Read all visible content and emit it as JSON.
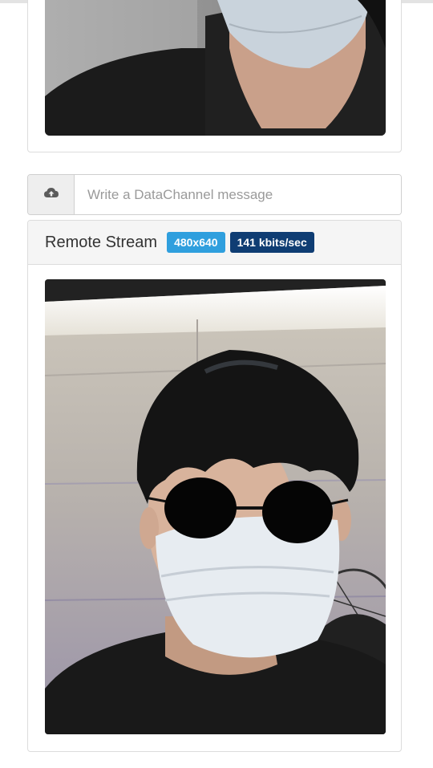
{
  "local_stream": {
    "video_icon": "video-feed"
  },
  "datachannel": {
    "placeholder": "Write a DataChannel message",
    "upload_icon": "cloud-upload-icon"
  },
  "remote_stream": {
    "title": "Remote Stream",
    "resolution_badge": "480x640",
    "bitrate_badge": "141 kbits/sec",
    "colors": {
      "resolution_badge": "#2f9fde",
      "bitrate_badge": "#0f3d73"
    }
  }
}
